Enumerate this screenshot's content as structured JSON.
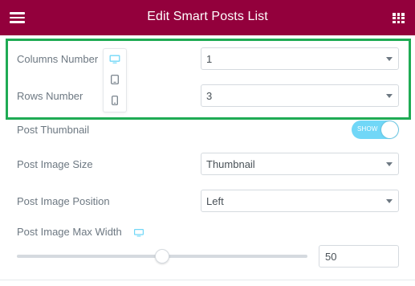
{
  "header": {
    "title": "Edit Smart Posts List",
    "background_color": "#93003c",
    "menu_icon": "hamburger-icon",
    "apps_icon": "grid-icon"
  },
  "highlight": {
    "color": "#1fab54"
  },
  "device_switcher": {
    "icons": [
      "desktop-icon",
      "tablet-icon",
      "mobile-icon"
    ],
    "active_color": "#71d7f7"
  },
  "controls": {
    "columns_number": {
      "label": "Columns Number",
      "value": "1"
    },
    "rows_number": {
      "label": "Rows Number",
      "value": "3"
    },
    "post_thumbnail": {
      "label": "Post Thumbnail",
      "toggle_text": "SHOW",
      "toggle_color": "#71d7f7",
      "enabled": true
    },
    "post_image_size": {
      "label": "Post Image Size",
      "value": "Thumbnail"
    },
    "post_image_position": {
      "label": "Post Image Position",
      "value": "Left"
    },
    "post_image_max_width": {
      "label": "Post Image Max Width",
      "value": "50",
      "responsive_icon": "desktop-icon",
      "slider_fraction": 0.5
    }
  }
}
